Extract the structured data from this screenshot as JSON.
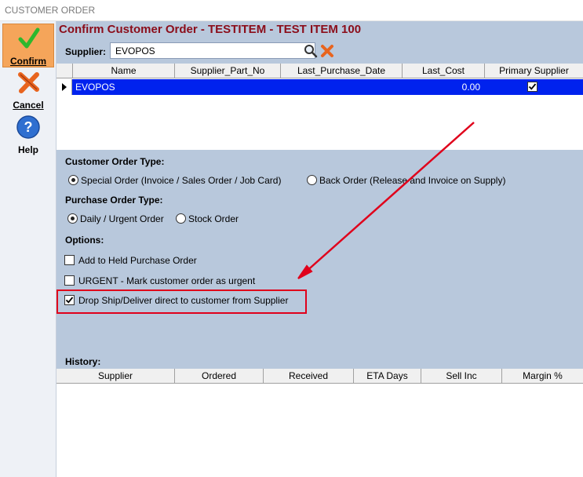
{
  "window": {
    "title": "CUSTOMER ORDER"
  },
  "sidebar": {
    "confirm_label": "Confirm",
    "cancel_label": "Cancel",
    "help_label": "Help"
  },
  "heading": "Confirm Customer Order - TESTITEM - TEST ITEM 100",
  "supplier": {
    "label": "Supplier:",
    "value": "EVOPOS"
  },
  "supplier_grid": {
    "columns": [
      "Name",
      "Supplier_Part_No",
      "Last_Purchase_Date",
      "Last_Cost",
      "Primary Supplier"
    ],
    "rows": [
      {
        "name": "EVOPOS",
        "part_no": "",
        "last_date": "",
        "last_cost": "0.00",
        "primary": true
      }
    ]
  },
  "customer_order_type": {
    "label": "Customer Order Type:",
    "options": [
      {
        "label": "Special Order (Invoice / Sales Order / Job Card)",
        "selected": true
      },
      {
        "label": "Back Order (Release and Invoice on Supply)",
        "selected": false
      }
    ]
  },
  "purchase_order_type": {
    "label": "Purchase Order Type:",
    "options": [
      {
        "label": "Daily / Urgent Order",
        "selected": true
      },
      {
        "label": "Stock Order",
        "selected": false
      }
    ]
  },
  "options": {
    "label": "Options:",
    "items": [
      {
        "label": "Add to Held Purchase Order",
        "checked": false
      },
      {
        "label": "URGENT - Mark customer order as urgent",
        "checked": false
      },
      {
        "label": "Drop Ship/Deliver direct to customer from Supplier",
        "checked": true
      }
    ]
  },
  "history": {
    "label": "History:",
    "columns": [
      "Supplier",
      "Ordered",
      "Received",
      "ETA Days",
      "Sell Inc",
      "Margin %"
    ]
  },
  "colors": {
    "heading": "#8b0d1a",
    "panel": "#b8c8dc",
    "selection": "#0022ee",
    "annotation": "#e0001b"
  }
}
